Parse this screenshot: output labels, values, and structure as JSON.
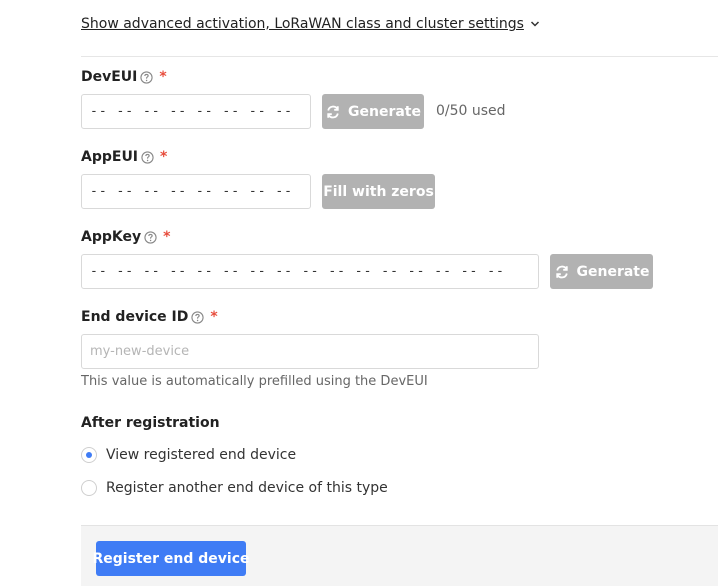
{
  "advanced_link": "Show advanced activation, LoRaWAN class and cluster settings",
  "fields": {
    "deveui": {
      "label": "DevEUI",
      "value": "-- -- -- -- -- -- -- --",
      "generate_label": "Generate",
      "usage": "0/50 used"
    },
    "appeui": {
      "label": "AppEUI",
      "value": "-- -- -- -- -- -- -- --",
      "fill_label": "Fill with zeros"
    },
    "appkey": {
      "label": "AppKey",
      "value": "-- -- -- -- -- -- -- -- -- -- -- -- -- -- -- --",
      "generate_label": "Generate"
    },
    "end_device_id": {
      "label": "End device ID",
      "placeholder": "my-new-device",
      "helper": "This value is automatically prefilled using the DevEUI"
    }
  },
  "after_registration": {
    "title": "After registration",
    "options": [
      {
        "label": "View registered end device",
        "selected": true
      },
      {
        "label": "Register another end device of this type",
        "selected": false
      }
    ]
  },
  "submit_label": "Register end device",
  "colors": {
    "primary": "#3f7cf5",
    "disabled_button": "#b2b2b2",
    "required": "#e74c3c"
  },
  "icons": {
    "help": "question-circle-icon",
    "refresh": "refresh-icon",
    "chevron": "chevron-down-icon"
  }
}
